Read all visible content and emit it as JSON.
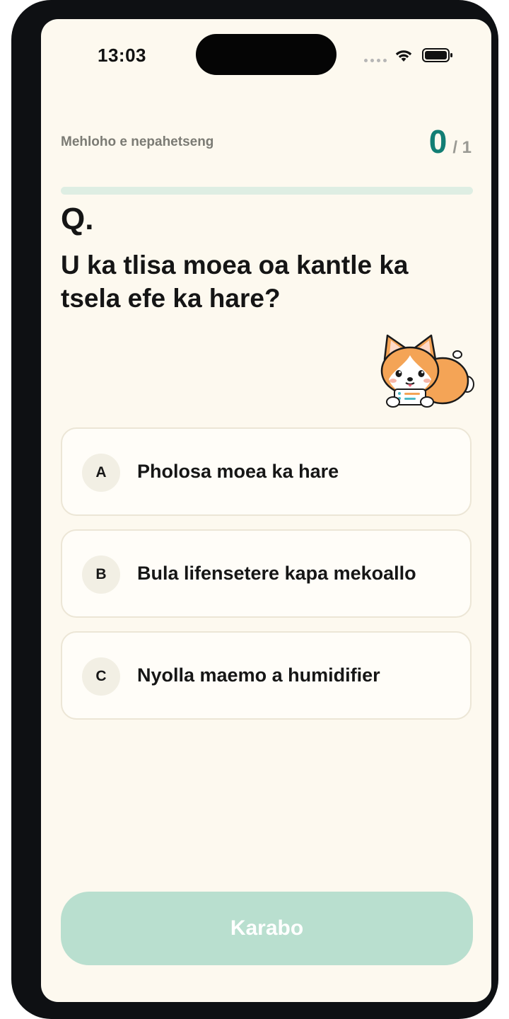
{
  "status_bar": {
    "time": "13:03",
    "icons": [
      "signal-dots-icon",
      "wifi-icon",
      "battery-icon"
    ]
  },
  "quiz": {
    "label": "Mehloho e nepahetseng",
    "score_current": "0",
    "score_total": "/ 1",
    "progress": 0,
    "question_marker": "Q.",
    "question": "U ka tlisa moea oa kantle ka tsela efe ka hare?"
  },
  "options": [
    {
      "letter": "A",
      "text": "Pholosa moea ka hare"
    },
    {
      "letter": "B",
      "text": "Bula lifensetere kapa mekoallo"
    },
    {
      "letter": "C",
      "text": "Nyolla maemo a humidifier"
    }
  ],
  "submit": {
    "label": "Karabo"
  },
  "colors": {
    "accent": "#127e74",
    "background": "#fdf9ef",
    "progress_track": "#deeee3",
    "button_disabled": "#b9dfcf"
  }
}
